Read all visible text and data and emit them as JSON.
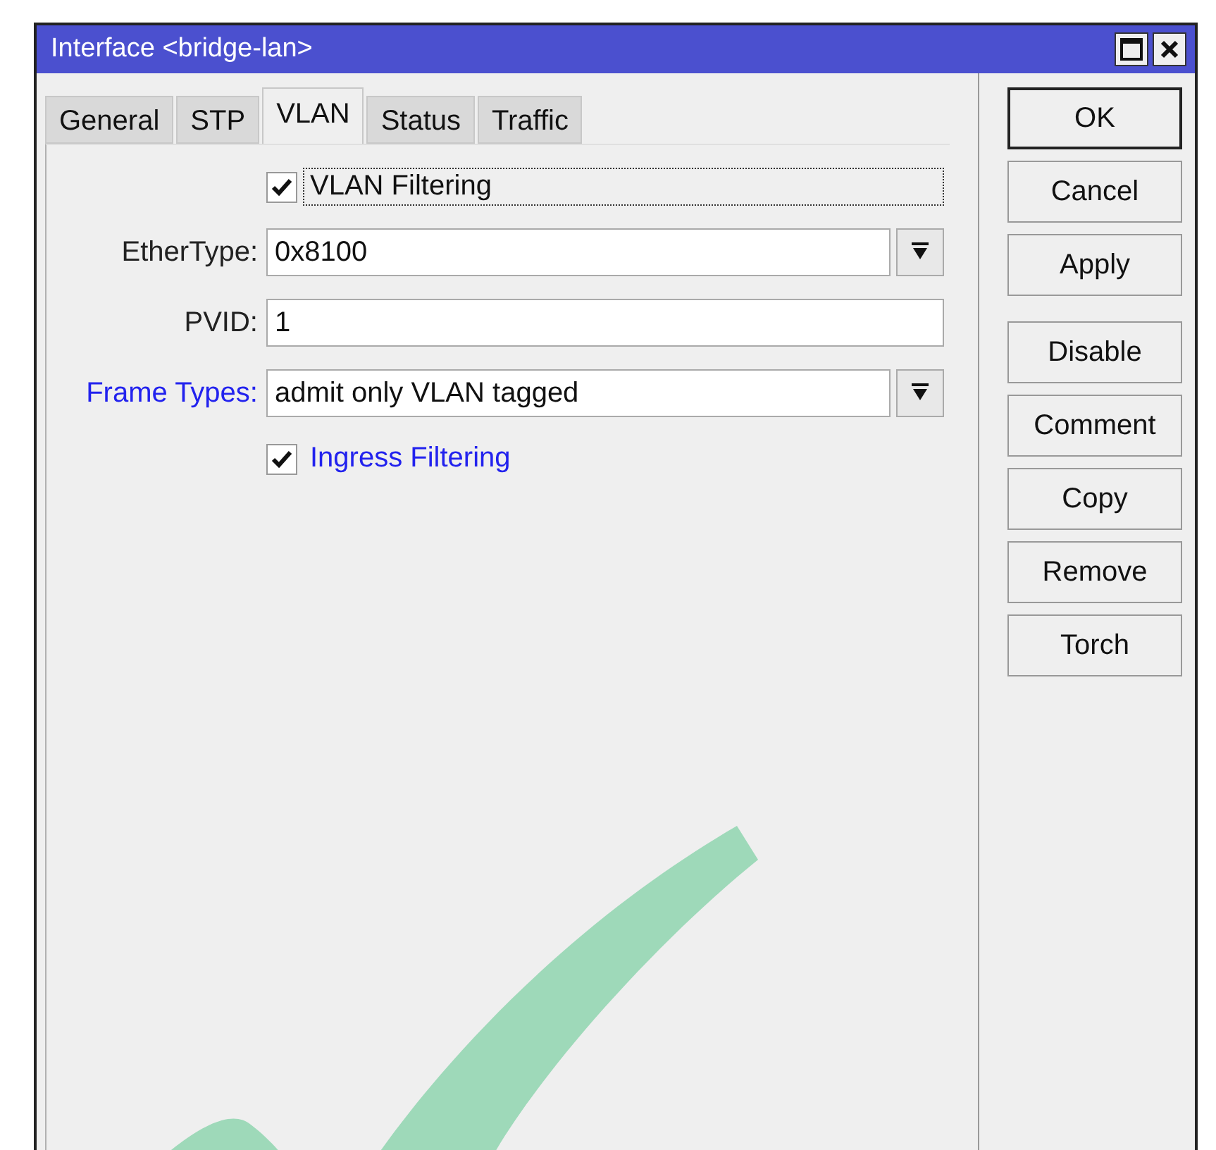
{
  "window": {
    "title": "Interface <bridge-lan>"
  },
  "tabs": [
    {
      "label": "General",
      "selected": false
    },
    {
      "label": "STP",
      "selected": false
    },
    {
      "label": "VLAN",
      "selected": true
    },
    {
      "label": "Status",
      "selected": false
    },
    {
      "label": "Traffic",
      "selected": false
    }
  ],
  "fields": [
    {
      "kind": "checkbox",
      "label": "VLAN Filtering",
      "checked": true,
      "focused": true,
      "highlighted": false
    },
    {
      "kind": "dropdown",
      "label": "EtherType:",
      "value": "0x8100",
      "highlighted": false
    },
    {
      "kind": "text",
      "label": "PVID:",
      "value": "1",
      "highlighted": false
    },
    {
      "kind": "dropdown",
      "label": "Frame Types:",
      "value": "admit only VLAN tagged",
      "highlighted": true
    },
    {
      "kind": "checkbox",
      "label": "Ingress Filtering",
      "checked": true,
      "focused": false,
      "highlighted": true
    }
  ],
  "button_groups": [
    [
      {
        "label": "OK",
        "default": true
      },
      {
        "label": "Cancel",
        "default": false
      },
      {
        "label": "Apply",
        "default": false
      }
    ],
    [
      {
        "label": "Disable",
        "default": false
      },
      {
        "label": "Comment",
        "default": false
      },
      {
        "label": "Copy",
        "default": false
      },
      {
        "label": "Remove",
        "default": false
      },
      {
        "label": "Torch",
        "default": false
      }
    ]
  ],
  "overlay": {
    "kind": "checkmark"
  }
}
